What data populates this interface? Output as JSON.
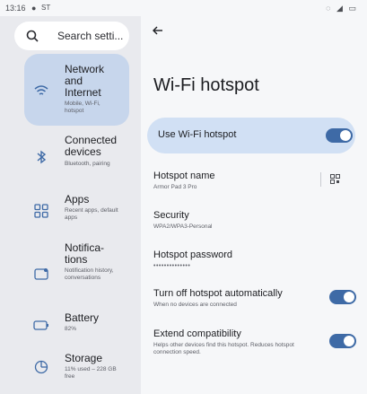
{
  "status": {
    "time": "13:16",
    "carrier": "ST"
  },
  "search": {
    "placeholder": "Search setti..."
  },
  "sidebar": {
    "items": [
      {
        "title": "Network and Internet",
        "subtitle": "Mobile, Wi-Fi, hotspot",
        "icon": "wifi-icon",
        "selected": true
      },
      {
        "title": "Connected devices",
        "subtitle": "Bluetooth, pairing",
        "icon": "bluetooth-icon"
      },
      {
        "title": "Apps",
        "subtitle": "Recent apps, default apps",
        "icon": "apps-grid-icon"
      },
      {
        "title": "Notifica-tions",
        "subtitle": "Notification history, conversations",
        "icon": "notifications-icon"
      },
      {
        "title": "Battery",
        "subtitle": "82%",
        "icon": "battery-icon"
      },
      {
        "title": "Storage",
        "subtitle": "11% used – 228 GB free",
        "icon": "storage-icon"
      }
    ]
  },
  "main": {
    "title": "Wi-Fi hotspot",
    "use_hotspot": {
      "label": "Use Wi-Fi hotspot",
      "on": true
    },
    "hotspot_name": {
      "title": "Hotspot name",
      "value": "Armor Pad 3 Pro"
    },
    "security": {
      "title": "Security",
      "value": "WPA2/WPA3-Personal"
    },
    "password": {
      "title": "Hotspot password",
      "value": "••••••••••••••"
    },
    "auto_off": {
      "title": "Turn off hotspot automatically",
      "subtitle": "When no devices are connected",
      "on": true
    },
    "extend": {
      "title": "Extend compatibility",
      "subtitle": "Helps other devices find this hotspot. Reduces hotspot connection speed.",
      "on": true
    }
  },
  "colors": {
    "accent": "#3e6aa6",
    "selected_bg": "#c7d6ec",
    "card_bg": "#d1e0f4",
    "sidebar_bg": "#e9eaee"
  }
}
